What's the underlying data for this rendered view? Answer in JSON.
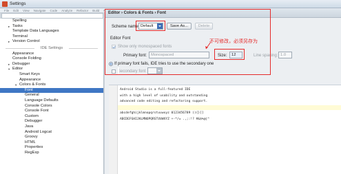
{
  "window": {
    "title": "Settings"
  },
  "menubar": {
    "items": [
      "File",
      "Edit",
      "View",
      "Navigate",
      "Code",
      "Analyze",
      "Refactor",
      "Build",
      "Run",
      "Tools",
      "VCS",
      "Window",
      "Help"
    ]
  },
  "tree": {
    "items": [
      {
        "label": "Spelling",
        "arrow": ""
      },
      {
        "label": "Tasks",
        "arrow": "▸"
      },
      {
        "label": "Template Data Languages",
        "arrow": ""
      },
      {
        "label": "Terminal",
        "arrow": ""
      },
      {
        "label": "Version Control",
        "arrow": "▸"
      }
    ],
    "section": "IDE Settings",
    "ide_items": [
      {
        "label": "Appearance",
        "arrow": ""
      },
      {
        "label": "Console Folding",
        "arrow": ""
      },
      {
        "label": "Debugger",
        "arrow": "▸"
      },
      {
        "label": "Editor",
        "arrow": "▾"
      },
      {
        "label": "Smart Keys",
        "arrow": ""
      },
      {
        "label": "Appearance",
        "arrow": ""
      },
      {
        "label": "Colors & Fonts",
        "arrow": "▾"
      },
      {
        "label": "Font",
        "arrow": ""
      },
      {
        "label": "General",
        "arrow": ""
      },
      {
        "label": "Language Defaults",
        "arrow": ""
      },
      {
        "label": "Console Colors",
        "arrow": ""
      },
      {
        "label": "Console Font",
        "arrow": ""
      },
      {
        "label": "Custom",
        "arrow": ""
      },
      {
        "label": "Debugger",
        "arrow": ""
      },
      {
        "label": "Java",
        "arrow": ""
      },
      {
        "label": "Android Logcat",
        "arrow": ""
      },
      {
        "label": "Groovy",
        "arrow": ""
      },
      {
        "label": "HTML",
        "arrow": ""
      },
      {
        "label": "Properties",
        "arrow": ""
      },
      {
        "label": "RegExp",
        "arrow": ""
      }
    ]
  },
  "header": {
    "breadcrumb": "Editor › Colors & Fonts › Font"
  },
  "scheme": {
    "label": "Scheme name:",
    "value": "Default",
    "save_as": "Save As...",
    "delete": "Delete"
  },
  "editor_font": {
    "section": "Editor Font",
    "show_mono": "Show only monospaced fonts",
    "primary_label": "Primary font:",
    "primary_value": "Monospaced",
    "size_label": "Size:",
    "size_value": "12",
    "spacing_label": "Line spacing:",
    "spacing_value": "1.0",
    "fallback": "If primary font fails, IDE tries to use the secondary one",
    "secondary_label": "Secondary font"
  },
  "annotation": "不可修改，必须另存为",
  "preview": {
    "lines": [
      "Android Studio is a full-featured IDE",
      "with a high level of usability and outstanding",
      "advanced code editing and refactoring support.",
      "",
      "abcdefghijklmnopqrstuvwxyz 0123456789 (){}[]",
      "ABCDEFGHIJKLMNOPQRSTUVWXYZ +-*/= .,;:!? #&$%@|^"
    ]
  },
  "colors": {
    "accent": "#3f77c4",
    "annotation": "#e52b2b"
  }
}
